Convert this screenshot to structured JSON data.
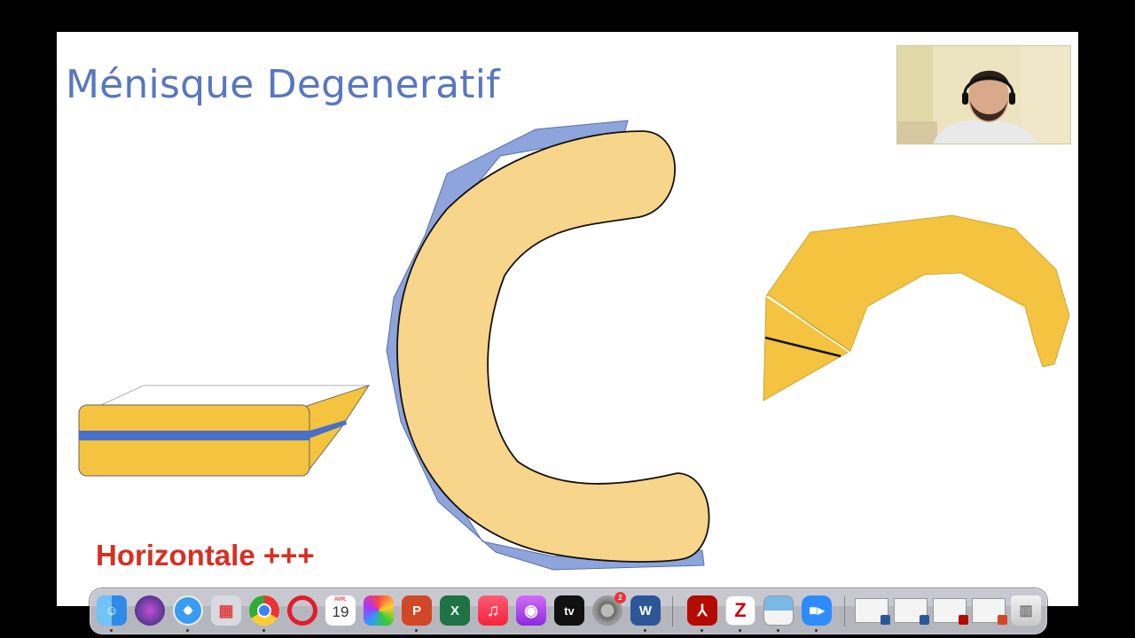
{
  "slide": {
    "title": "Ménisque Degeneratif",
    "note": "Horizontale +++"
  },
  "colors": {
    "title": "#5876c1",
    "note": "#d72f22",
    "meniscus_light": "#f7d58a",
    "meniscus_dark": "#f4c33f",
    "synovial_blue": "#8ea4dc",
    "cleavage_blue": "#4a6fc9"
  },
  "webcam": {
    "subject": "presenter-webcam"
  },
  "dock": {
    "apps": [
      {
        "name": "finder-icon"
      },
      {
        "name": "siri-icon"
      },
      {
        "name": "safari-icon"
      },
      {
        "name": "launchpad-icon"
      },
      {
        "name": "chrome-icon"
      },
      {
        "name": "opera-icon"
      },
      {
        "name": "calendar-icon",
        "month": "AVR.",
        "day": "19"
      },
      {
        "name": "photos-icon"
      },
      {
        "name": "powerpoint-icon",
        "glyph": "P"
      },
      {
        "name": "excel-icon",
        "glyph": "X"
      },
      {
        "name": "music-icon",
        "glyph": "♫"
      },
      {
        "name": "podcasts-icon"
      },
      {
        "name": "appletv-icon",
        "glyph": "tv"
      },
      {
        "name": "system-preferences-icon",
        "badge": "2"
      },
      {
        "name": "word-icon",
        "glyph": "W"
      },
      {
        "name": "acrobat-icon"
      },
      {
        "name": "zotero-icon",
        "glyph": "Z"
      },
      {
        "name": "preview-icon"
      },
      {
        "name": "zoom-icon"
      },
      {
        "name": "trash-icon"
      }
    ]
  }
}
